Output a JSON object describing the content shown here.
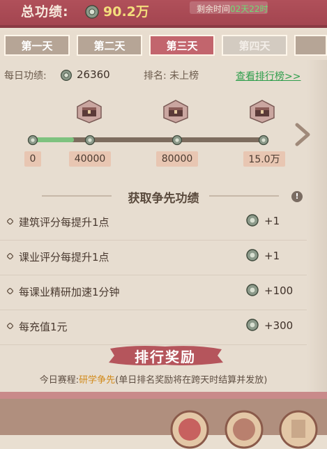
{
  "header": {
    "total_label": "总功绩:",
    "total_value": "90.2万",
    "remaining_label": "剩余时间",
    "remaining_time": "02天22时"
  },
  "tabs": [
    {
      "label": "第一天",
      "state": "normal"
    },
    {
      "label": "第二天",
      "state": "normal"
    },
    {
      "label": "第三天",
      "state": "active"
    },
    {
      "label": "第四天",
      "state": "locked"
    }
  ],
  "daily": {
    "label": "每日功绩:",
    "value": "26360",
    "rank_label": "排名: 未上榜",
    "rank_link": "查看排行榜>>"
  },
  "milestones": {
    "labels": [
      "0",
      "40000",
      "80000",
      "15.0万"
    ],
    "progress_fraction": 0.18
  },
  "section": {
    "title": "获取争先功绩",
    "info_icon": "!"
  },
  "tasks": [
    {
      "text": "建筑评分每提升1点",
      "value": "+1"
    },
    {
      "text": "课业评分每提升1点",
      "value": "+1"
    },
    {
      "text": "每课业精研加速1分钟",
      "value": "+100"
    },
    {
      "text": "每充值1元",
      "value": "+300"
    }
  ],
  "reward": {
    "title": "排行奖励",
    "note_prefix": "今日赛程:",
    "note_highlight": "研学争先",
    "note_suffix": "(单日排名奖励将在跨天时结算并发放)"
  },
  "colors": {
    "header_bg": "#a84a55",
    "active_tab": "#c2656d",
    "progress_fill": "#7ec27f",
    "link_green": "#2f9e4c",
    "gold_text": "#f4de7c"
  },
  "icons": [
    "merit-coin-icon",
    "chest-icon",
    "chevron-right-icon",
    "diamond-bullet-icon",
    "info-icon"
  ]
}
